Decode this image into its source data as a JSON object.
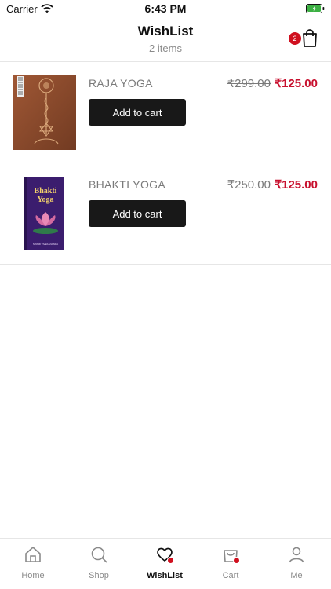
{
  "status": {
    "carrier": "Carrier",
    "time": "6:43 PM"
  },
  "header": {
    "title": "WishList",
    "subtitle": "2 items",
    "cart_count": "2"
  },
  "items": [
    {
      "name": "RAJA YOGA",
      "price_old": "₹299.00",
      "price_new": "₹125.00",
      "button": "Add to cart",
      "image": "raja-yoga-cover"
    },
    {
      "name": "BHAKTI YOGA",
      "price_old": "₹250.00",
      "price_new": "₹125.00",
      "button": "Add to cart",
      "image": "bhakti-yoga-cover"
    }
  ],
  "book2_cover": {
    "title_line1": "Bhakti",
    "title_line2": "Yoga",
    "author": "SWAMI VIVEKANANDA"
  },
  "tabs": [
    {
      "label": "Home",
      "icon": "home-icon"
    },
    {
      "label": "Shop",
      "icon": "search-icon"
    },
    {
      "label": "WishList",
      "icon": "heart-icon",
      "active": true
    },
    {
      "label": "Cart",
      "icon": "bag-icon"
    },
    {
      "label": "Me",
      "icon": "user-icon"
    }
  ],
  "colors": {
    "accent": "#d0101f",
    "price": "#c8102e",
    "button": "#181818"
  }
}
